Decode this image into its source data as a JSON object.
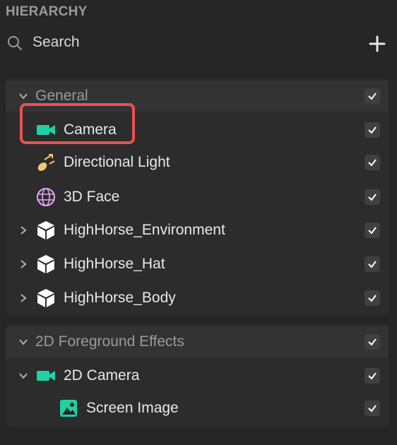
{
  "panel_title": "HIERARCHY",
  "search": {
    "placeholder": "Search"
  },
  "groups": [
    {
      "label": "General",
      "items": [
        {
          "label": "Camera",
          "icon": "camera-icon",
          "icon_color": "#1fd1a5"
        },
        {
          "label": "Directional Light",
          "icon": "directional-light-icon",
          "icon_color": "#f2c872"
        },
        {
          "label": "3D Face",
          "icon": "face-mesh-icon",
          "icon_color": "#e7a7f5",
          "highlighted": true
        },
        {
          "label": "HighHorse_Environment",
          "icon": "cube-icon",
          "icon_color": "#ffffff",
          "expandable": true
        },
        {
          "label": "HighHorse_Hat",
          "icon": "cube-icon",
          "icon_color": "#ffffff",
          "expandable": true
        },
        {
          "label": "HighHorse_Body",
          "icon": "cube-icon",
          "icon_color": "#ffffff",
          "expandable": true
        }
      ]
    },
    {
      "label": "2D Foreground Effects",
      "items": [
        {
          "label": "2D Camera",
          "icon": "camera-icon",
          "icon_color": "#1fd1a5",
          "expanded": true
        },
        {
          "label": "Screen Image",
          "icon": "image-icon",
          "icon_color": "#1fd1a5"
        }
      ]
    }
  ],
  "colors": {
    "highlight": "#e85352",
    "accent": "#1fd1a5",
    "background": "#262626"
  }
}
